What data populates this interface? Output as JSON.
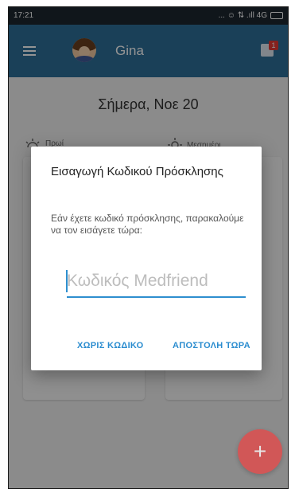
{
  "status_bar": {
    "time": "17:21",
    "indicators": "... ☺ ⇅ .ıll 4G"
  },
  "app_bar": {
    "user_name": "Gina",
    "notification_count": "1"
  },
  "main": {
    "date_heading": "Σήμερα, Νοε 20",
    "periods": [
      "Πρωί",
      "Μεσημέρι"
    ]
  },
  "dialog": {
    "title": "Εισαγωγή Κωδικού Πρόσκλησης",
    "message": "Εάν έχετε κωδικό πρόσκλησης, παρακαλούμε να τον εισάγετε τώρα:",
    "input_placeholder": "Κωδικός Medfriend",
    "input_value": "",
    "skip_button": "ΧΩΡΙΣ ΚΩΔΙΚΟ",
    "send_button": "ΑΠΟΣΤΟΛΗ ΤΩΡΑ"
  },
  "fab": {
    "label": "+"
  },
  "colors": {
    "app_bar": "#2e6f98",
    "accent": "#2a8ccf",
    "fab": "#e34b4b"
  }
}
